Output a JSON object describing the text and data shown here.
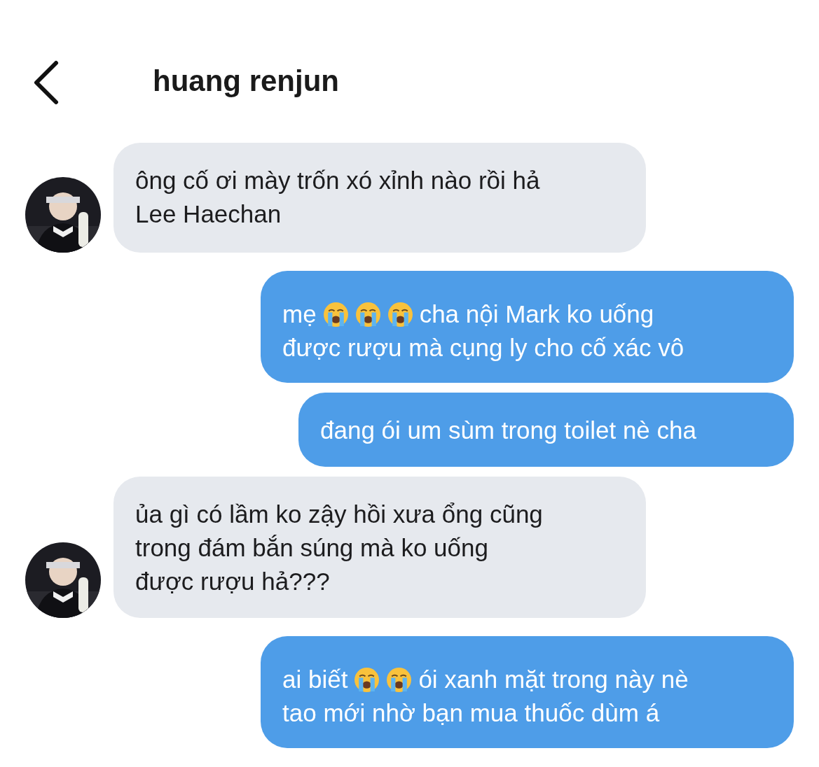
{
  "header": {
    "title": "huang renjun"
  },
  "messages": [
    {
      "kind": "incoming",
      "lines": [
        [
          {
            "kind": "text",
            "text": "ông cố ơi mày trốn xó xỉnh nào rồi hả"
          }
        ],
        [
          {
            "kind": "text",
            "text": "Lee Haechan"
          }
        ]
      ]
    },
    {
      "kind": "outgoing",
      "lines": [
        [
          {
            "kind": "text",
            "text": "mẹ"
          },
          {
            "kind": "crying-emoji"
          },
          {
            "kind": "crying-emoji"
          },
          {
            "kind": "crying-emoji"
          },
          {
            "kind": "text",
            "text": "cha nội Mark ko uống"
          }
        ],
        [
          {
            "kind": "text",
            "text": "được rượu mà cụng ly cho cố xác vô"
          }
        ]
      ]
    },
    {
      "kind": "outgoing",
      "lines": [
        [
          {
            "kind": "text",
            "text": "đang ói um sùm trong toilet nè cha"
          }
        ]
      ]
    },
    {
      "kind": "incoming",
      "lines": [
        [
          {
            "kind": "text",
            "text": "ủa gì có lầm ko zậy hồi xưa ổng cũng"
          }
        ],
        [
          {
            "kind": "text",
            "text": "trong đám bắn súng mà ko uống"
          }
        ],
        [
          {
            "kind": "text",
            "text": "được rượu hả???"
          }
        ]
      ]
    },
    {
      "kind": "outgoing",
      "lines": [
        [
          {
            "kind": "text",
            "text": "ai biết"
          },
          {
            "kind": "crying-emoji"
          },
          {
            "kind": "crying-emoji"
          },
          {
            "kind": "text",
            "text": "ói xanh mặt trong này nè"
          }
        ],
        [
          {
            "kind": "text",
            "text": "tao mới nhờ bạn mua thuốc dùm á"
          }
        ]
      ]
    }
  ]
}
